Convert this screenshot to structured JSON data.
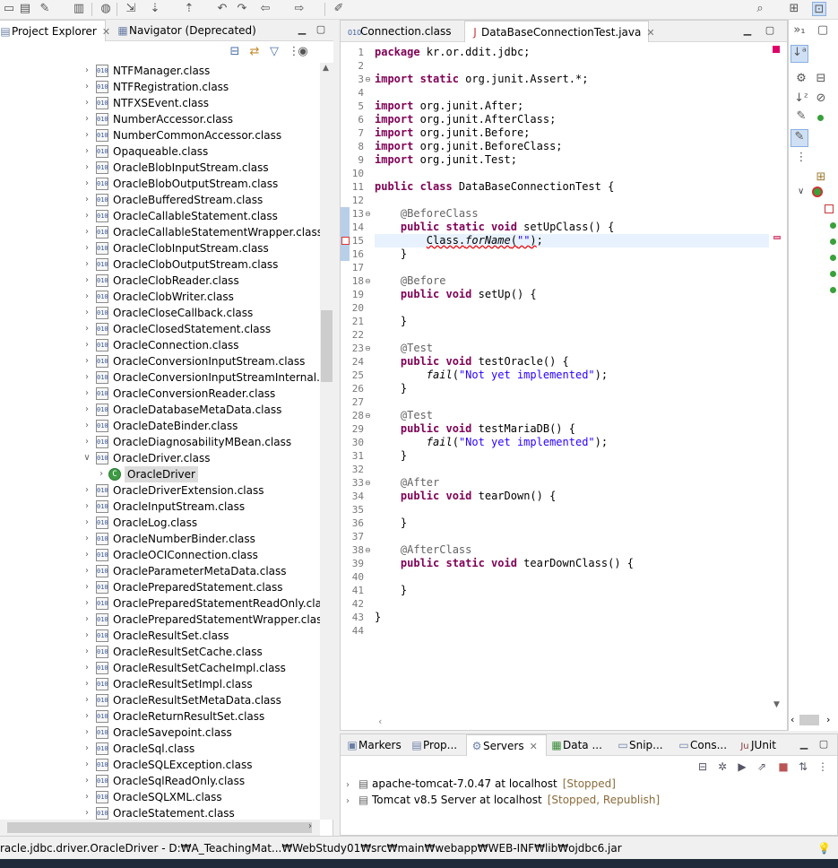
{
  "left_panel": {
    "tabs": [
      {
        "label": "Project Explorer",
        "close": "✕"
      },
      {
        "label": "Navigator (Deprecated)"
      }
    ],
    "tree_items": [
      "NTFManager.class",
      "NTFRegistration.class",
      "NTFXSEvent.class",
      "NumberAccessor.class",
      "NumberCommonAccessor.class",
      "Opaqueable.class",
      "OracleBlobInputStream.class",
      "OracleBlobOutputStream.class",
      "OracleBufferedStream.class",
      "OracleCallableStatement.class",
      "OracleCallableStatementWrapper.class",
      "OracleClobInputStream.class",
      "OracleClobOutputStream.class",
      "OracleClobReader.class",
      "OracleClobWriter.class",
      "OracleCloseCallback.class",
      "OracleClosedStatement.class",
      "OracleConnection.class",
      "OracleConversionInputStream.class",
      "OracleConversionInputStreamInternal.class",
      "OracleConversionReader.class",
      "OracleDatabaseMetaData.class",
      "OracleDateBinder.class",
      "OracleDiagnosabilityMBean.class",
      "OracleDriver.class",
      "OracleDriver",
      "OracleDriverExtension.class",
      "OracleInputStream.class",
      "OracleLog.class",
      "OracleNumberBinder.class",
      "OracleOCIConnection.class",
      "OracleParameterMetaData.class",
      "OraclePreparedStatement.class",
      "OraclePreparedStatementReadOnly.class",
      "OraclePreparedStatementWrapper.class",
      "OracleResultSet.class",
      "OracleResultSetCache.class",
      "OracleResultSetCacheImpl.class",
      "OracleResultSetImpl.class",
      "OracleResultSetMetaData.class",
      "OracleReturnResultSet.class",
      "OracleSavepoint.class",
      "OracleSql.class",
      "OracleSQLException.class",
      "OracleSqlReadOnly.class",
      "OracleSQLXML.class",
      "OracleStatement.class"
    ],
    "tree_class_badge": "010"
  },
  "editor": {
    "tabs": [
      {
        "label": "Connection.class"
      },
      {
        "label": "DataBaseConnectionTest.java",
        "close": "✕"
      }
    ],
    "line_numbers": [
      "1",
      "2",
      "3",
      "4",
      "5",
      "6",
      "7",
      "8",
      "9",
      "10",
      "11",
      "12",
      "13",
      "14",
      "15",
      "16",
      "17",
      "18",
      "19",
      "20",
      "21",
      "22",
      "23",
      "24",
      "25",
      "26",
      "27",
      "28",
      "29",
      "30",
      "31",
      "32",
      "33",
      "34",
      "35",
      "36",
      "37",
      "38",
      "39",
      "40",
      "41",
      "42",
      "43",
      "44"
    ],
    "lines": [
      {
        "html": "<span class='kw'>package</span> kr.or.ddit.jdbc;"
      },
      {
        "html": ""
      },
      {
        "html": "<span class='kw'>import static</span> org.junit.Assert.*;"
      },
      {
        "html": ""
      },
      {
        "html": "<span class='kw'>import</span> org.junit.After;"
      },
      {
        "html": "<span class='kw'>import</span> org.junit.AfterClass;"
      },
      {
        "html": "<span class='kw'>import</span> org.junit.Before;"
      },
      {
        "html": "<span class='kw'>import</span> org.junit.BeforeClass;"
      },
      {
        "html": "<span class='kw'>import</span> org.junit.Test;"
      },
      {
        "html": ""
      },
      {
        "html": "<span class='kw'>public class</span> DataBaseConnectionTest {"
      },
      {
        "html": ""
      },
      {
        "html": "    <span class='an'>@BeforeClass</span>"
      },
      {
        "html": "    <span class='kw'>public static void</span> setUpClass() {"
      },
      {
        "html": "        <span class='err'>Class.<span class='it'>forName</span>(<span class='st'>\"\"</span>)</span>;",
        "highlight": true
      },
      {
        "html": "    }"
      },
      {
        "html": ""
      },
      {
        "html": "    <span class='an'>@Before</span>"
      },
      {
        "html": "    <span class='kw'>public void</span> setUp() {"
      },
      {
        "html": ""
      },
      {
        "html": "    }"
      },
      {
        "html": ""
      },
      {
        "html": "    <span class='an'>@Test</span>"
      },
      {
        "html": "    <span class='kw'>public void</span> testOracle() {"
      },
      {
        "html": "        <span class='it'>fail</span>(<span class='st'>\"Not yet implemented\"</span>);"
      },
      {
        "html": "    }"
      },
      {
        "html": ""
      },
      {
        "html": "    <span class='an'>@Test</span>"
      },
      {
        "html": "    <span class='kw'>public void</span> testMariaDB() {"
      },
      {
        "html": "        <span class='it'>fail</span>(<span class='st'>\"Not yet implemented\"</span>);"
      },
      {
        "html": "    }"
      },
      {
        "html": ""
      },
      {
        "html": "    <span class='an'>@After</span>"
      },
      {
        "html": "    <span class='kw'>public void</span> tearDown() {"
      },
      {
        "html": ""
      },
      {
        "html": "    }"
      },
      {
        "html": ""
      },
      {
        "html": "    <span class='an'>@AfterClass</span>"
      },
      {
        "html": "    <span class='kw'>public static void</span> tearDownClass() {"
      },
      {
        "html": ""
      },
      {
        "html": "    }"
      },
      {
        "html": ""
      },
      {
        "html": "}"
      },
      {
        "html": ""
      }
    ]
  },
  "bottom_panel": {
    "tabs": [
      {
        "label": "Markers"
      },
      {
        "label": "Prop..."
      },
      {
        "label": "Servers",
        "close": "✕"
      },
      {
        "label": "Data ..."
      },
      {
        "label": "Snip..."
      },
      {
        "label": "Cons..."
      },
      {
        "label": "JUnit"
      }
    ],
    "junit_badge": "Ju",
    "servers": [
      {
        "name": "apache-tomcat-7.0.47 at localhost",
        "status": "[Stopped]"
      },
      {
        "name": "Tomcat v8.5 Server at localhost",
        "status": "[Stopped, Republish]"
      }
    ]
  },
  "status_bar": {
    "text": "racle.jdbc.driver.OracleDriver - D:₩A_TeachingMat...₩WebStudy01₩src₩main₩webapp₩WEB-INF₩lib₩ojdbc6.jar"
  },
  "colors": {
    "keyword": "#7f0055",
    "string": "#2a00ff",
    "annotation": "#646464",
    "selection": "#dcdcdc",
    "current_line": "#e8f2fe"
  }
}
